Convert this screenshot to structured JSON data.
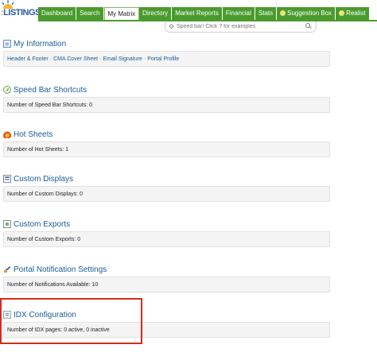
{
  "brand": {
    "logo_text": "LISTINGS",
    "logo_accent": "#e3a21a",
    "logo_color": "#2a5aa7"
  },
  "nav": {
    "tabs": [
      {
        "label": "Dashboard",
        "active": false
      },
      {
        "label": "Search",
        "active": false
      },
      {
        "label": "My Matrix",
        "active": true
      },
      {
        "label": "Directory",
        "active": false
      },
      {
        "label": "Market Reports",
        "active": false
      },
      {
        "label": "Financial",
        "active": false
      },
      {
        "label": "Stats",
        "active": false
      },
      {
        "label": "Suggestion Box",
        "active": false,
        "icon": "lightbulb-icon"
      },
      {
        "label": "Realist",
        "active": false,
        "icon": "lightbulb-icon"
      }
    ],
    "accent": "#4a9b2e"
  },
  "speedbar": {
    "placeholder": "Speed bar! Click ? for examples"
  },
  "sections": {
    "my_information": {
      "title": "My Information",
      "links": [
        "Header & Footer",
        "CMA Cover Sheet",
        "Email Signature",
        "Portal Profile"
      ],
      "separator": "·"
    },
    "speed_bar": {
      "title": "Speed Bar Shortcuts",
      "text": "Number of Speed Bar Shortcuts: 0"
    },
    "hot_sheets": {
      "title": "Hot Sheets",
      "text": "Number of Hot Sheets: 1"
    },
    "custom_displays": {
      "title": "Custom Displays",
      "text": "Number of Custom Displays: 0"
    },
    "custom_exports": {
      "title": "Custom Exports",
      "text": "Number of Custom Exports: 0"
    },
    "portal": {
      "title": "Portal Notification Settings",
      "text": "Number of Notifications Available: 10"
    },
    "idx": {
      "title": "IDX Configuration",
      "text": "Number of IDX pages: 0 active, 0 inactive"
    }
  },
  "colors": {
    "link": "#1a5c95",
    "highlight_frame": "#d52b1e"
  }
}
